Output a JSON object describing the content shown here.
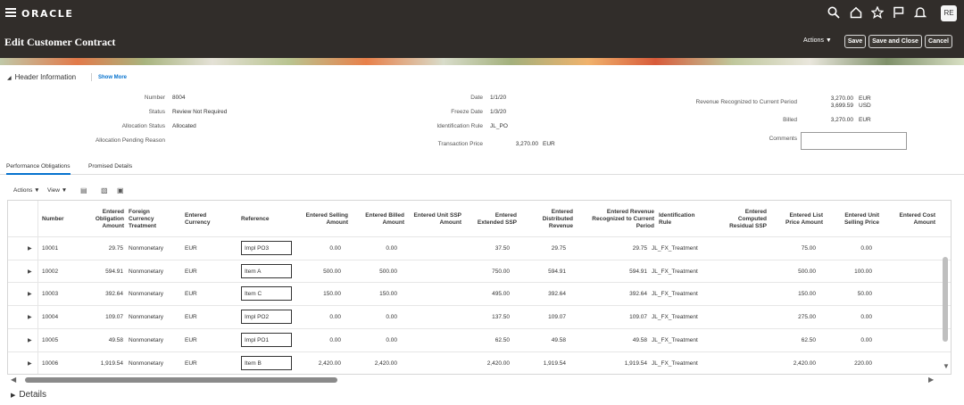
{
  "app": {
    "brand": "ORACLE",
    "user_initials": "RE",
    "page_title": "Edit Customer Contract"
  },
  "toolbar": {
    "actions_label": "Actions",
    "save_label": "Save",
    "save_close_label": "Save and Close",
    "cancel_label": "Cancel"
  },
  "header": {
    "section_title": "Header Information",
    "show_more_label": "Show More",
    "fields": {
      "number_label": "Number",
      "number_value": "8004",
      "status_label": "Status",
      "status_value": "Review Not Required",
      "allocation_status_label": "Allocation Status",
      "allocation_status_value": "Allocated",
      "allocation_pending_reason_label": "Allocation Pending Reason",
      "date_label": "Date",
      "date_value": "1/1/20",
      "freeze_date_label": "Freeze Date",
      "freeze_date_value": "1/3/20",
      "identification_rule_label": "Identification Rule",
      "identification_rule_value": "JL_PO",
      "transaction_price_label": "Transaction Price",
      "transaction_price_value": "3,270.00",
      "transaction_price_currency": "EUR",
      "revenue_recognized_label": "Revenue Recognized to Current Period",
      "revenue_recognized_value1": "3,270.00",
      "revenue_recognized_currency1": "EUR",
      "revenue_recognized_value2": "3,699.59",
      "revenue_recognized_currency2": "USD",
      "billed_label": "Billed",
      "billed_value": "3,270.00",
      "billed_currency": "EUR",
      "comments_label": "Comments"
    }
  },
  "tabs": [
    {
      "label": "Performance Obligations",
      "active": true
    },
    {
      "label": "Promised Details",
      "active": false
    }
  ],
  "table_toolbar": {
    "actions_label": "Actions",
    "view_label": "View"
  },
  "table": {
    "columns": {
      "number": "Number",
      "entered_obligation_amount": "Entered Obligation Amount",
      "foreign_currency_treatment": "Foreign Currency Treatment",
      "entered_currency": "Entered Currency",
      "reference": "Reference",
      "entered_selling_amount": "Entered Selling Amount",
      "entered_billed_amount": "Entered Billed Amount",
      "entered_unit_ssp_amount": "Entered Unit SSP Amount",
      "entered_extended_ssp": "Entered Extended SSP",
      "entered_distributed_revenue": "Entered Distributed Revenue",
      "entered_revenue_recognized": "Entered Revenue Recognized to Current Period",
      "identification_rule": "Identification Rule",
      "entered_computed_residual_ssp": "Entered Computed Residual SSP",
      "entered_list_price_amount": "Entered List Price Amount",
      "entered_unit_selling_price": "Entered Unit Selling Price",
      "entered_cost_amount": "Entered Cost Amount"
    },
    "rows": [
      {
        "number": "10001",
        "obligation": "29.75",
        "treatment": "Nonmonetary",
        "currency": "EUR",
        "reference": "Impl PO3",
        "selling": "0.00",
        "billed": "0.00",
        "unit_ssp": "",
        "extended_ssp": "37.50",
        "distributed": "29.75",
        "recognized": "29.75",
        "rule": "JL_FX_Treatment",
        "residual": "",
        "list_price": "75.00",
        "unit_selling": "0.00"
      },
      {
        "number": "10002",
        "obligation": "594.91",
        "treatment": "Nonmonetary",
        "currency": "EUR",
        "reference": "Item A",
        "selling": "500.00",
        "billed": "500.00",
        "unit_ssp": "",
        "extended_ssp": "750.00",
        "distributed": "594.91",
        "recognized": "594.91",
        "rule": "JL_FX_Treatment",
        "residual": "",
        "list_price": "500.00",
        "unit_selling": "100.00"
      },
      {
        "number": "10003",
        "obligation": "392.64",
        "treatment": "Nonmonetary",
        "currency": "EUR",
        "reference": "Item C",
        "selling": "150.00",
        "billed": "150.00",
        "unit_ssp": "",
        "extended_ssp": "495.00",
        "distributed": "392.64",
        "recognized": "392.64",
        "rule": "JL_FX_Treatment",
        "residual": "",
        "list_price": "150.00",
        "unit_selling": "50.00"
      },
      {
        "number": "10004",
        "obligation": "109.07",
        "treatment": "Nonmonetary",
        "currency": "EUR",
        "reference": "Impl PO2",
        "selling": "0.00",
        "billed": "0.00",
        "unit_ssp": "",
        "extended_ssp": "137.50",
        "distributed": "109.07",
        "recognized": "109.07",
        "rule": "JL_FX_Treatment",
        "residual": "",
        "list_price": "275.00",
        "unit_selling": "0.00"
      },
      {
        "number": "10005",
        "obligation": "49.58",
        "treatment": "Nonmonetary",
        "currency": "EUR",
        "reference": "Impl PO1",
        "selling": "0.00",
        "billed": "0.00",
        "unit_ssp": "",
        "extended_ssp": "62.50",
        "distributed": "49.58",
        "recognized": "49.58",
        "rule": "JL_FX_Treatment",
        "residual": "",
        "list_price": "62.50",
        "unit_selling": "0.00"
      },
      {
        "number": "10006",
        "obligation": "1,919.54",
        "treatment": "Nonmonetary",
        "currency": "EUR",
        "reference": "Item B",
        "selling": "2,420.00",
        "billed": "2,420.00",
        "unit_ssp": "",
        "extended_ssp": "2,420.00",
        "distributed": "1,919.54",
        "recognized": "1,919.54",
        "rule": "JL_FX_Treatment",
        "residual": "",
        "list_price": "2,420.00",
        "unit_selling": "220.00"
      }
    ]
  },
  "details_label": "Details",
  "icons": [
    "menu-icon",
    "search-icon",
    "home-icon",
    "star-icon",
    "flag-icon",
    "bell-icon",
    "export-icon",
    "freeze-icon",
    "detach-icon"
  ]
}
